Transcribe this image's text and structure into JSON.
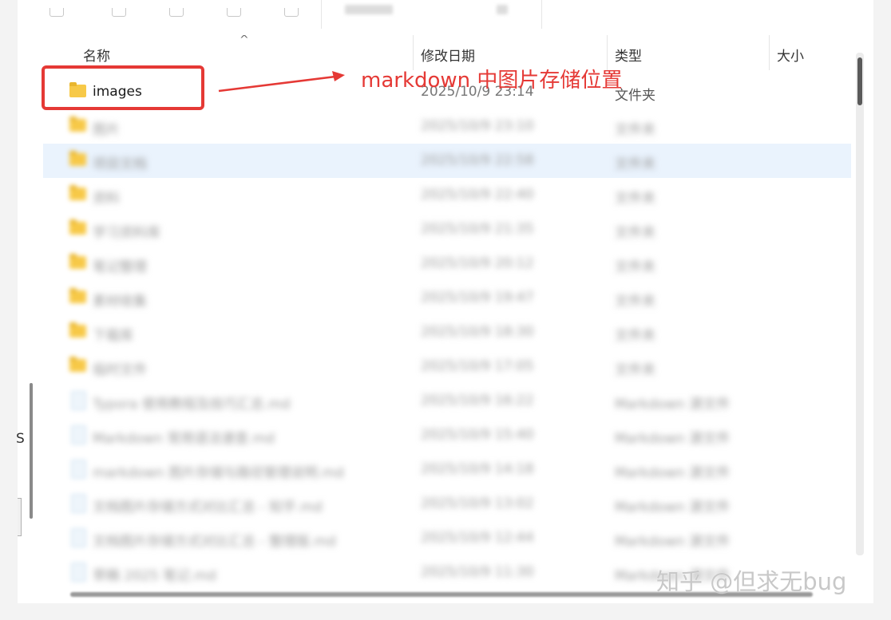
{
  "columns": {
    "name": "名称",
    "modified": "修改日期",
    "type": "类型",
    "size": "大小"
  },
  "highlighted_row": {
    "name": "images",
    "modified": "2025/10/9 23:14",
    "type": "文件夹",
    "icon": "folder-icon"
  },
  "blurred_rows": [
    {
      "name": "图片",
      "modified": "2025/10/9 23:10",
      "type": "文件夹",
      "icon": "folder-icon"
    },
    {
      "name": "项目文档",
      "modified": "2025/10/9 22:58",
      "type": "文件夹",
      "icon": "folder-icon"
    },
    {
      "name": "资料",
      "modified": "2025/10/9 22:40",
      "type": "文件夹",
      "icon": "folder-icon"
    },
    {
      "name": "学习资料库",
      "modified": "2025/10/9 21:35",
      "type": "文件夹",
      "icon": "folder-icon"
    },
    {
      "name": "笔记整理",
      "modified": "2025/10/9 20:12",
      "type": "文件夹",
      "icon": "folder-icon"
    },
    {
      "name": "素材收集",
      "modified": "2025/10/9 19:47",
      "type": "文件夹",
      "icon": "folder-icon"
    },
    {
      "name": "下载库",
      "modified": "2025/10/9 18:30",
      "type": "文件夹",
      "icon": "folder-icon"
    },
    {
      "name": "临时文件",
      "modified": "2025/10/9 17:05",
      "type": "文件夹",
      "icon": "folder-icon"
    },
    {
      "name": "Typora 使用教程及技巧汇总.md",
      "modified": "2025/10/9 16:22",
      "type": "Markdown 源文件",
      "icon": "md-file-icon"
    },
    {
      "name": "Markdown 常用语法速查.md",
      "modified": "2025/10/9 15:40",
      "type": "Markdown 源文件",
      "icon": "md-file-icon"
    },
    {
      "name": "markdown 图片存储与路径管理说明.md",
      "modified": "2025/10/9 14:18",
      "type": "Markdown 源文件",
      "icon": "md-file-icon"
    },
    {
      "name": "文档图片存储方式对比汇总 - 知乎.md",
      "modified": "2025/10/9 13:02",
      "type": "Markdown 源文件",
      "icon": "md-file-icon"
    },
    {
      "name": "文档图片存储方式对比汇总 - 整理版.md",
      "modified": "2025/10/9 12:44",
      "type": "Markdown 源文件",
      "icon": "md-file-icon"
    },
    {
      "name": "草稿 2025 笔记.md",
      "modified": "2025/10/9 11:30",
      "type": "Markdown 源文件",
      "icon": "md-file-icon"
    }
  ],
  "annotation": {
    "text": "markdown 中图片存储位置",
    "color": "#e53935"
  },
  "left_edge_letter": "S",
  "watermark": "知乎 @但求无bug",
  "colors": {
    "selection": "#eaf3fd",
    "folder": "#f7c948",
    "highlight": "#e53935"
  }
}
